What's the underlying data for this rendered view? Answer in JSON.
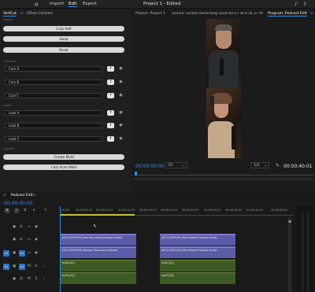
{
  "menu": {
    "home": "⌂",
    "import": "Import",
    "edit": "Edit",
    "export": "Export"
  },
  "window_title": "Project 1 - Edited",
  "left_tabs": {
    "tab1": "VertCut",
    "tab2": "Effect Controls"
  },
  "vertcut": {
    "crop_half": "Crop Half",
    "swap": "Swap",
    "reset": "Reset",
    "section_cameras": "Cameras",
    "cams": [
      "Cam A",
      "Cam B",
      "Cam C"
    ],
    "section_looks": "Looks",
    "looks": [
      "Look A",
      "Look B",
      "Look C"
    ],
    "section_layouts": "Layouts",
    "create_mold": "Create Mold",
    "cast_from_mold": "Cast From Mold"
  },
  "monitor_tabs": {
    "project": "Project: Project 1",
    "source": "Source: Screen Recording 2024-04-27 at 6.54.27 PM.mov",
    "program": "Program: Podcast Edit"
  },
  "program": {
    "timecode": "00:00:00:00",
    "fit": "Fit",
    "quality": "1/4",
    "duration": "00:00:40:01"
  },
  "timeline": {
    "title": "Podcast Edit",
    "timecode": "00:00:00:00",
    "ruler": [
      "00:00",
      "00:00:04:23",
      "00:00:09:23",
      "00:00:14:23",
      "00:00:19:23",
      "00:00:24:23",
      "00:00:29:23",
      "00:00:34:23",
      "00:00:39:23",
      "00:00:44:22",
      "00:00:49:22"
    ],
    "tracks": {
      "v1": "V1",
      "a1": "A1"
    },
    "clips": {
      "v_top_1": "[MC2] 6350345_Man Discussing Podcast Studio",
      "v_top_2": "[MC1] 6350345_Man Woman Podcast Studio",
      "v_bot_1": "[MC2] 6350345_Woman Discussing Podcast",
      "v_bot_2": "[MC1] 6350345_Man Woman Podcast Studio",
      "a1_1": "multi [A1]",
      "a1_2": "multi [A1]",
      "a2_1": "multi [A2]",
      "a2_2": "multi [A2]"
    }
  }
}
